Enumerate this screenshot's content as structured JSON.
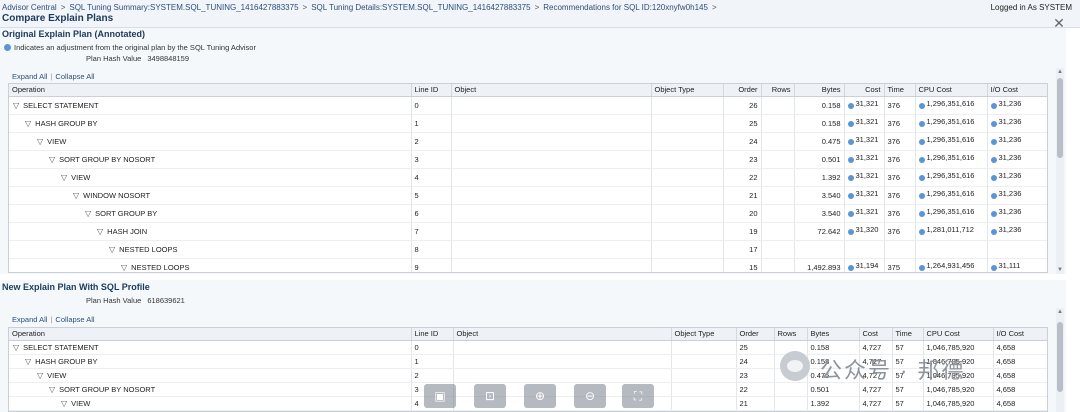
{
  "breadcrumb": [
    "Advisor Central",
    "SQL Tuning Summary:SYSTEM.SQL_TUNING_1416427883375",
    "SQL Tuning Details:SYSTEM.SQL_TUNING_1416427883375",
    "Recommendations for SQL ID:120xnyfw0h145"
  ],
  "breadcrumb_separator": ">",
  "logged_in": "Logged in As SYSTEM",
  "page_title": "Compare Explain Plans",
  "original": {
    "title": "Original Explain Plan (Annotated)",
    "info": "Indicates an adjustment from the original plan by the SQL Tuning Advisor",
    "hash_label": "Plan Hash Value",
    "hash_value": "3498848159",
    "expand_all": "Expand All",
    "collapse_all": "Collapse All",
    "columns": [
      "Operation",
      "Line ID",
      "Object",
      "Object Type",
      "Order",
      "Rows",
      "Bytes",
      "Cost",
      "Time",
      "CPU Cost",
      "I/O Cost"
    ],
    "rows": [
      {
        "op": "SELECT STATEMENT",
        "indent": 0,
        "line": "0",
        "object": "",
        "otype": "",
        "order": "26",
        "rows": "",
        "bytes": "0.158",
        "cost": "31,321",
        "time": "376",
        "cpu": "1,296,351,616",
        "io": "31,236",
        "mark": true
      },
      {
        "op": "HASH GROUP BY",
        "indent": 1,
        "line": "1",
        "object": "",
        "otype": "",
        "order": "25",
        "rows": "",
        "bytes": "0.158",
        "cost": "31,321",
        "time": "376",
        "cpu": "1,296,351,616",
        "io": "31,236",
        "mark": true
      },
      {
        "op": "VIEW",
        "indent": 2,
        "line": "2",
        "object": "",
        "otype": "",
        "order": "24",
        "rows": "",
        "bytes": "0.475",
        "cost": "31,321",
        "time": "376",
        "cpu": "1,296,351,616",
        "io": "31,236",
        "mark": true
      },
      {
        "op": "SORT GROUP BY NOSORT",
        "indent": 3,
        "line": "3",
        "object": "",
        "otype": "",
        "order": "23",
        "rows": "",
        "bytes": "0.501",
        "cost": "31,321",
        "time": "376",
        "cpu": "1,296,351,616",
        "io": "31,236",
        "mark": true
      },
      {
        "op": "VIEW",
        "indent": 4,
        "line": "4",
        "object": "",
        "otype": "",
        "order": "22",
        "rows": "",
        "bytes": "1.392",
        "cost": "31,321",
        "time": "376",
        "cpu": "1,296,351,616",
        "io": "31,236",
        "mark": true
      },
      {
        "op": "WINDOW NOSORT",
        "indent": 5,
        "line": "5",
        "object": "",
        "otype": "",
        "order": "21",
        "rows": "",
        "bytes": "3.540",
        "cost": "31,321",
        "time": "376",
        "cpu": "1,296,351,616",
        "io": "31,236",
        "mark": true
      },
      {
        "op": "SORT GROUP BY",
        "indent": 6,
        "line": "6",
        "object": "",
        "otype": "",
        "order": "20",
        "rows": "",
        "bytes": "3.540",
        "cost": "31,321",
        "time": "376",
        "cpu": "1,296,351,616",
        "io": "31,236",
        "mark": true
      },
      {
        "op": "HASH JOIN",
        "indent": 7,
        "line": "7",
        "object": "",
        "otype": "",
        "order": "19",
        "rows": "",
        "bytes": "72.642",
        "cost": "31,320",
        "time": "376",
        "cpu": "1,281,011,712",
        "io": "31,236",
        "mark": true
      },
      {
        "op": "NESTED LOOPS",
        "indent": 8,
        "line": "8",
        "object": "",
        "otype": "",
        "order": "17",
        "rows": "",
        "bytes": "",
        "cost": "",
        "time": "",
        "cpu": "",
        "io": "",
        "mark": false
      },
      {
        "op": "NESTED LOOPS",
        "indent": 9,
        "line": "9",
        "object": "",
        "otype": "",
        "order": "15",
        "rows": "",
        "bytes": "1,492.893",
        "cost": "31,194",
        "time": "375",
        "cpu": "1,264,931,456",
        "io": "31,111",
        "mark": true
      }
    ]
  },
  "new_plan": {
    "title": "New Explain Plan With SQL Profile",
    "hash_label": "Plan Hash Value",
    "hash_value": "618639621",
    "expand_all": "Expand All",
    "collapse_all": "Collapse All",
    "columns": [
      "Operation",
      "Line ID",
      "Object",
      "Object Type",
      "Order",
      "Rows",
      "Bytes",
      "Cost",
      "Time",
      "CPU Cost",
      "I/O Cost"
    ],
    "rows": [
      {
        "op": "SELECT STATEMENT",
        "indent": 0,
        "line": "0",
        "object": "",
        "otype": "",
        "order": "25",
        "rows": "",
        "bytes": "0.158",
        "cost": "4,727",
        "time": "57",
        "cpu": "1,046,785,920",
        "io": "4,658"
      },
      {
        "op": "HASH GROUP BY",
        "indent": 1,
        "line": "1",
        "object": "",
        "otype": "",
        "order": "24",
        "rows": "",
        "bytes": "0.158",
        "cost": "4,727",
        "time": "57",
        "cpu": "1,046,785,920",
        "io": "4,658"
      },
      {
        "op": "VIEW",
        "indent": 2,
        "line": "2",
        "object": "",
        "otype": "",
        "order": "23",
        "rows": "",
        "bytes": "0.475",
        "cost": "4,727",
        "time": "57",
        "cpu": "1,046,785,920",
        "io": "4,658"
      },
      {
        "op": "SORT GROUP BY NOSORT",
        "indent": 3,
        "line": "3",
        "object": "",
        "otype": "",
        "order": "22",
        "rows": "",
        "bytes": "0.501",
        "cost": "4,727",
        "time": "57",
        "cpu": "1,046,785,920",
        "io": "4,658"
      },
      {
        "op": "VIEW",
        "indent": 4,
        "line": "4",
        "object": "",
        "otype": "",
        "order": "21",
        "rows": "",
        "bytes": "1.392",
        "cost": "4,727",
        "time": "57",
        "cpu": "1,046,785,920",
        "io": "4,658"
      }
    ]
  },
  "watermark": "公众号 · 邦德",
  "viewer_toolbar": [
    "image-icon",
    "fit-icon",
    "zoom-in-icon",
    "zoom-out-icon",
    "fullscreen-icon"
  ],
  "icons": {
    "expand_toggle": "triangle-down-icon",
    "annotation": "info-dot-icon",
    "close": "close-icon"
  },
  "colors": {
    "link": "#2d4f7c",
    "title": "#1a3a5c",
    "annotation_dot": "#5a95d6",
    "header_bg": "#eef1f5"
  }
}
